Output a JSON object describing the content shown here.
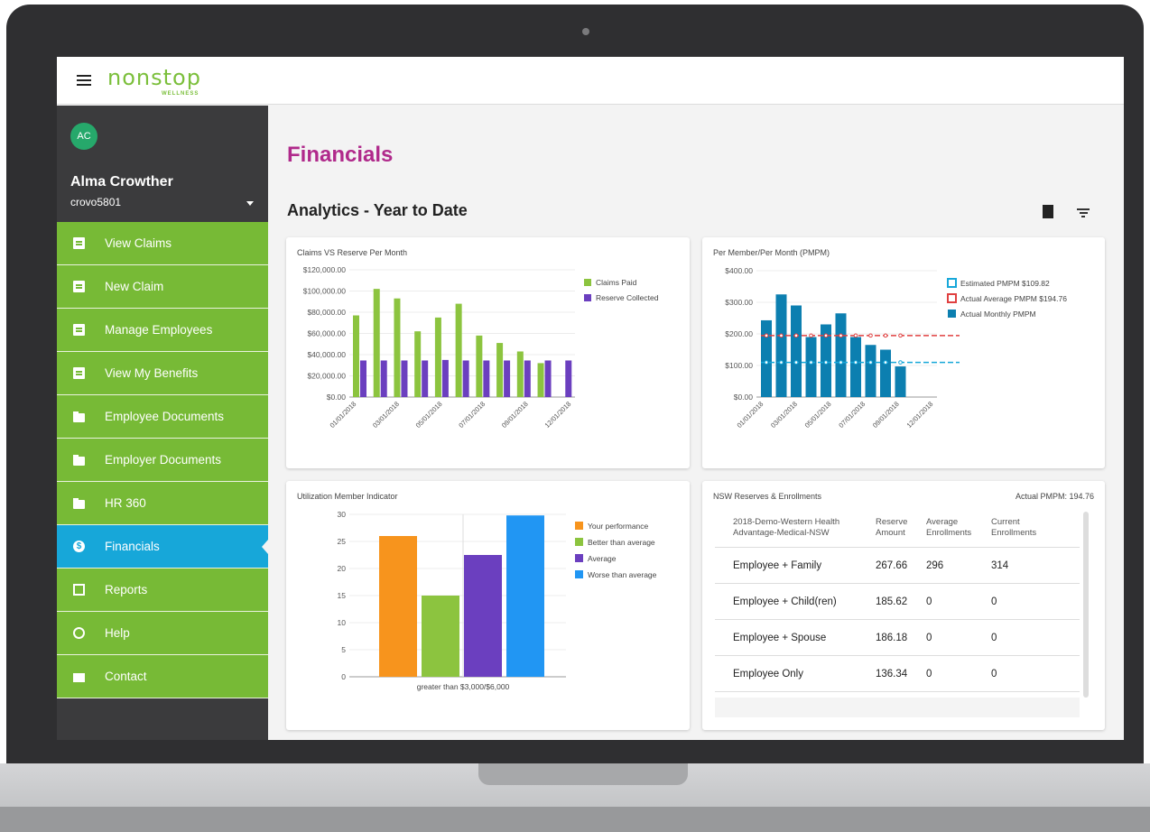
{
  "app": {
    "brand": "nonstop",
    "brand_sub": "WELLNESS"
  },
  "user": {
    "initials": "AC",
    "name": "Alma Crowther",
    "username": "crovo5801"
  },
  "nav": [
    {
      "label": "View Claims",
      "icon": "search-document-icon"
    },
    {
      "label": "New Claim",
      "icon": "add-document-icon"
    },
    {
      "label": "Manage Employees",
      "icon": "clipboard-icon"
    },
    {
      "label": "View My Benefits",
      "icon": "document-icon"
    },
    {
      "label": "Employee Documents",
      "icon": "folder-icon"
    },
    {
      "label": "Employer Documents",
      "icon": "folder-icon"
    },
    {
      "label": "HR 360",
      "icon": "folder-icon"
    },
    {
      "label": "Financials",
      "icon": "dollar-icon",
      "active": true
    },
    {
      "label": "Reports",
      "icon": "window-icon"
    },
    {
      "label": "Help",
      "icon": "help-icon"
    },
    {
      "label": "Contact",
      "icon": "mail-icon"
    }
  ],
  "main": {
    "title": "Financials",
    "section": "Analytics -  Year to Date"
  },
  "colors": {
    "green": "#77ba36",
    "blue": "#17a7d9",
    "purple": "#6b3fbf",
    "magenta": "#b02a8b",
    "orange": "#f7941d",
    "lightblue": "#2196f3",
    "teal": "#0c7fb0",
    "red": "#e04040"
  },
  "chart_data": [
    {
      "type": "bar",
      "title": "Claims VS Reserve Per Month",
      "xticks": [
        "01/01/2018",
        "03/01/2018",
        "05/01/2018",
        "07/01/2018",
        "09/01/2018",
        "12/01/2018"
      ],
      "yticks": [
        "$120,000.00",
        "$100,000.00",
        "$80,000.00",
        "$60,000.00",
        "$40,000.00",
        "$20,000.00",
        "$0.00"
      ],
      "ylim": [
        0,
        120000
      ],
      "series": [
        {
          "name": "Claims Paid",
          "color": "#8cc43f",
          "values": [
            77000,
            102000,
            93000,
            62000,
            75000,
            88000,
            58000,
            51000,
            43000,
            32000,
            0
          ]
        },
        {
          "name": "Reserve Collected",
          "color": "#6b3fbf",
          "values": [
            34500,
            34500,
            34500,
            34500,
            35000,
            34500,
            34500,
            34500,
            34500,
            34500,
            34500
          ]
        }
      ]
    },
    {
      "type": "bar",
      "title": "Per Member/Per Month (PMPM)",
      "xticks": [
        "01/01/2018",
        "03/01/2018",
        "05/01/2018",
        "07/01/2018",
        "09/01/2018",
        "12/01/2018"
      ],
      "yticks": [
        "$400.00",
        "$300.00",
        "$200.00",
        "$100.00",
        "$0.00"
      ],
      "ylim": [
        0,
        400
      ],
      "series": [
        {
          "name": "Estimated PMPM $109.82",
          "color": "#17a7d9",
          "line": 109.82
        },
        {
          "name": "Actual Average PMPM $194.76",
          "color": "#e04040",
          "line": 194.76
        },
        {
          "name": "Actual Monthly PMPM",
          "color": "#0c7fb0",
          "values": [
            243,
            325,
            290,
            190,
            230,
            265,
            190,
            165,
            150,
            97
          ]
        }
      ]
    },
    {
      "type": "bar",
      "title": "Utilization Member Indicator",
      "categories": [
        "greater than $3,000/$6,000"
      ],
      "yticks": [
        "30",
        "25",
        "20",
        "15",
        "10",
        "5",
        "0"
      ],
      "ylim": [
        0,
        30
      ],
      "series": [
        {
          "name": "Your performance",
          "color": "#f7941d",
          "values": [
            26
          ]
        },
        {
          "name": "Better than average",
          "color": "#8cc43f",
          "values": [
            15
          ]
        },
        {
          "name": "Average",
          "color": "#6b3fbf",
          "values": [
            22.5
          ]
        },
        {
          "name": "Worse than average",
          "color": "#2196f3",
          "values": [
            29.8
          ]
        }
      ]
    }
  ],
  "table": {
    "title": "NSW Reserves & Enrollments",
    "pmpm": "Actual PMPM: 194.76",
    "plan": "2018-Demo-Western Health Advantage-Medical-NSW",
    "headers": [
      "Reserve Amount",
      "Average Enrollments",
      "Current Enrollments"
    ],
    "rows": [
      {
        "tier": "Employee + Family",
        "reserve": "267.66",
        "avg": "296",
        "current": "314"
      },
      {
        "tier": "Employee + Child(ren)",
        "reserve": "185.62",
        "avg": "0",
        "current": "0"
      },
      {
        "tier": "Employee + Spouse",
        "reserve": "186.18",
        "avg": "0",
        "current": "0"
      },
      {
        "tier": "Employee Only",
        "reserve": "136.34",
        "avg": "0",
        "current": "0"
      }
    ]
  }
}
